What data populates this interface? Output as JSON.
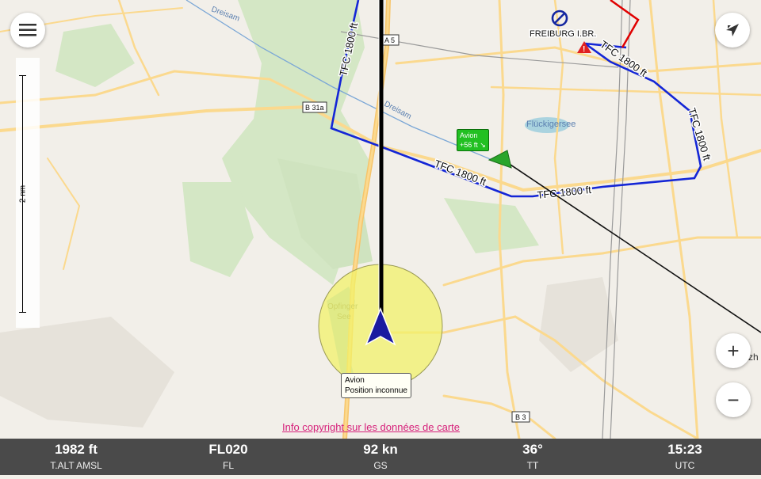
{
  "map": {
    "place_labels": [
      "FREIBURG I.BR.",
      "Flückigersee",
      "Opfinger See",
      "Dreisam",
      "Dreisam"
    ],
    "road_labels": [
      "A 5",
      "B 31a",
      "B 3"
    ],
    "airspace_labels": [
      "TFC 1800 ft",
      "TFC 1800 ft",
      "TFC 1800 ft",
      "TFC 1800 ft",
      "TFC 1800 ft"
    ],
    "partial_edge_text": "rzh",
    "own_aircraft": {
      "name": "Avion",
      "status": "Position inconnue"
    },
    "traffic": {
      "name": "Avion",
      "relative_altitude": "+56 ft ↘"
    },
    "scale": {
      "label": "2 nm"
    },
    "colors": {
      "airspace": "#1426d6",
      "track": "#000000",
      "traffic": "#2aa52a",
      "copyright_link": "#d6207a"
    }
  },
  "controls": {
    "menu_icon": "hamburger-menu-icon",
    "compass_icon": "north-arrow-icon",
    "zoom_in": "+",
    "zoom_out": "−"
  },
  "copyright_link": "Info copyright sur les données de carte",
  "status_bar": [
    {
      "value": "1982 ft",
      "label": "T.ALT AMSL"
    },
    {
      "value": "FL020",
      "label": "FL"
    },
    {
      "value": "92 kn",
      "label": "GS"
    },
    {
      "value": "36°",
      "label": "TT"
    },
    {
      "value": "15:23",
      "label": "UTC"
    }
  ]
}
